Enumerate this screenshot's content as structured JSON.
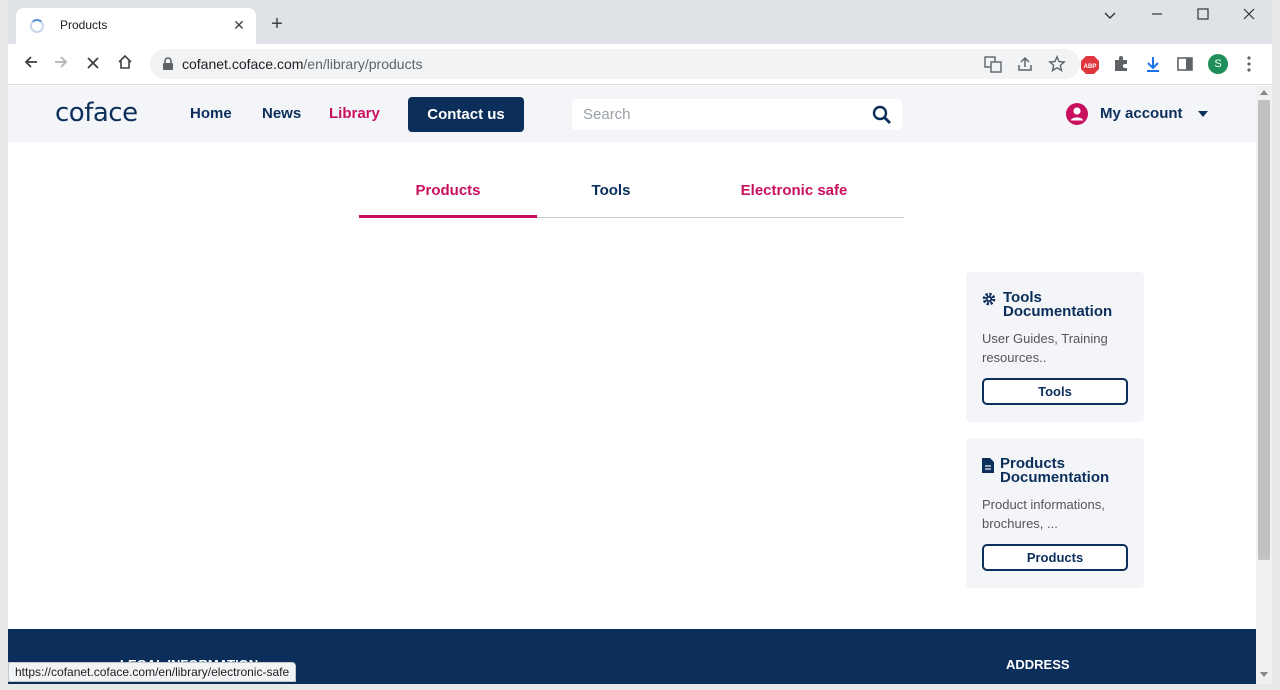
{
  "browser": {
    "tab_title": "Products",
    "tab_close": "✕",
    "new_tab": "+",
    "url_host": "cofanet.coface.com",
    "url_path": "/en/library/products",
    "profile_initial": "S",
    "status_url": "https://cofanet.coface.com/en/library/electronic-safe"
  },
  "header": {
    "logo_text": "coface",
    "nav": [
      {
        "label": "Home"
      },
      {
        "label": "News"
      },
      {
        "label": "Library"
      }
    ],
    "contact_label": "Contact us",
    "search_placeholder": "Search",
    "account_label": "My account"
  },
  "library_tabs": [
    {
      "label": "Products"
    },
    {
      "label": "Tools"
    },
    {
      "label": "Electronic safe"
    }
  ],
  "cards": [
    {
      "title": "Tools Documentation",
      "desc": "User Guides, Training resources..",
      "button": "Tools"
    },
    {
      "title": "Products Documentation",
      "desc": "Product informations, brochures, ...",
      "button": "Products"
    }
  ],
  "footer": {
    "legal": "LEGAL INFORMATION",
    "address": "ADDRESS"
  },
  "colors": {
    "brand_navy": "#0b2e5a",
    "accent_pink": "#c8105f"
  }
}
